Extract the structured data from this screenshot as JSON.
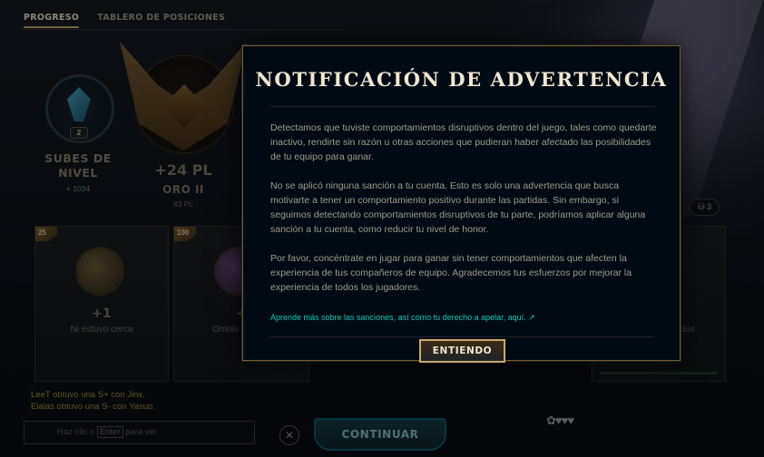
{
  "tabs": [
    {
      "label": "PROGRESO",
      "active": true
    },
    {
      "label": "TABLERO DE POSICIONES",
      "active": false
    }
  ],
  "level": {
    "badge": "2",
    "title": "SUBES DE NIVEL",
    "sub": "+ 1034"
  },
  "rank": {
    "pl_gain": "+24 PL",
    "tier": "ORO II",
    "tier_pl": "43 PL"
  },
  "counters": [
    "3"
  ],
  "cards": [
    {
      "num": "25",
      "plus": "+1",
      "label": "Ni estuvo cerca"
    },
    {
      "num": "100",
      "plus": "+",
      "label": "Omniv"
    },
    {
      "num": "",
      "plus": "",
      "label": "dos"
    }
  ],
  "chat": {
    "log": [
      "LeeT obtuvo una S+ con Jinx.",
      "Elaias obtuvo una S- con Yasuo."
    ],
    "input_prefix": "Haz clic o",
    "input_key": "Enter",
    "input_suffix": "para ver"
  },
  "continue_label": "CONTINUAR",
  "modal": {
    "title": "NOTIFICACIÓN DE ADVERTENCIA",
    "paragraphs": [
      "Detectamos que tuviste comportamientos disruptivos dentro del juego, tales como quedarte inactivo, rendirte sin razón u otras acciones que pudieran haber afectado las posibilidades de tu equipo para ganar.",
      "No se aplicó ninguna sanción a tu cuenta. Esto es solo una advertencia que busca motivarte a tener un comportamiento positivo durante las partidas. Sin embargo, si seguimos detectando comportamientos disruptivos de tu parte, podríamos aplicar alguna sanción a tu cuenta, como reducir tu nivel de honor.",
      "Por favor, concéntrate en jugar para ganar sin tener comportamientos que afecten la experiencia de tus compañeros de equipo. Agradecemos tus esfuerzos por mejorar la experiencia de todos los jugadores."
    ],
    "link": "Aprende más sobre las sanciones, así como tu derecho a apelar, aquí. ↗",
    "button": "ENTIENDO"
  },
  "colors": {
    "gold": "#c8aa6e",
    "teal_link": "#0ac8b9",
    "modal_bg": "#010a13"
  }
}
